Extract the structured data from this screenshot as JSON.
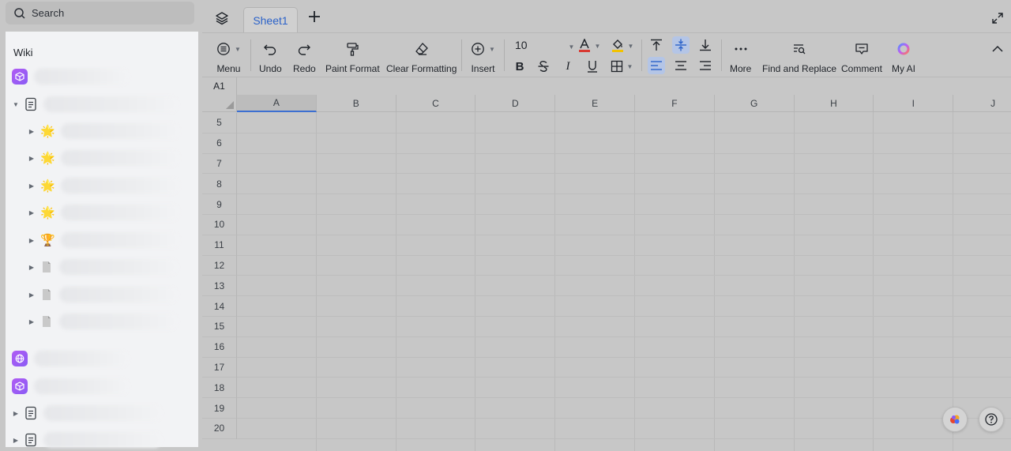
{
  "sidebar": {
    "search_placeholder": "Search",
    "section_label": "Wiki"
  },
  "sheet_tab": "Sheet1",
  "toolbar": {
    "menu": "Menu",
    "undo": "Undo",
    "redo": "Redo",
    "paint_format": "Paint Format",
    "clear_formatting": "Clear Formatting",
    "insert": "Insert",
    "font_size": "10",
    "more": "More",
    "find_replace": "Find and Replace",
    "comment": "Comment",
    "my_ai": "My AI"
  },
  "cell_reference": "A1",
  "columns": [
    "A",
    "B",
    "C",
    "D",
    "E",
    "F",
    "G",
    "H",
    "I",
    "J"
  ],
  "rows": [
    "5",
    "6",
    "7",
    "8",
    "9",
    "10",
    "11",
    "12",
    "13",
    "14",
    "15",
    "16",
    "17",
    "18",
    "19",
    "20"
  ],
  "colors": {
    "accent": "#2b62c9",
    "selection": "#3c6fd1",
    "font_color_bar": "#d83931",
    "fill_color_bar": "#f2c200"
  }
}
